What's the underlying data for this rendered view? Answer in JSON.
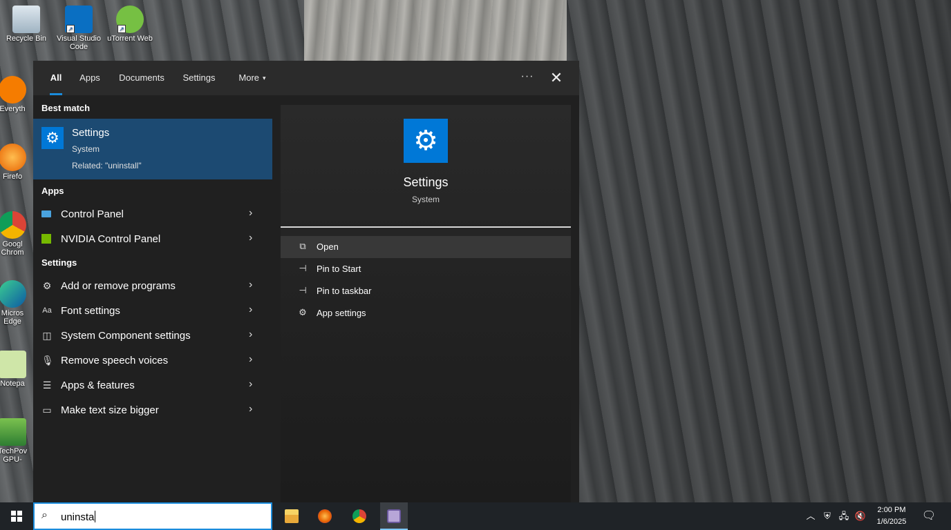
{
  "desktop": {
    "icons": [
      {
        "label": "Recycle Bin"
      },
      {
        "label": "Visual Studio Code"
      },
      {
        "label": "uTorrent Web"
      },
      {
        "label": "Everyth"
      },
      {
        "label": "Firefo"
      },
      {
        "label": "Googl Chrom"
      },
      {
        "label": "Micros Edge"
      },
      {
        "label": "Notepa"
      },
      {
        "label": "TechPov GPU-"
      }
    ]
  },
  "search_panel": {
    "tabs": [
      {
        "label": "All",
        "active": true
      },
      {
        "label": "Apps"
      },
      {
        "label": "Documents"
      },
      {
        "label": "Settings"
      },
      {
        "label": "More"
      }
    ],
    "more_caret": "▾",
    "ellipsis": "···",
    "close": "✕",
    "best_match": {
      "heading": "Best match",
      "title": "Settings",
      "subtitle": "System",
      "related": "Related: \"uninstall\"",
      "icon": "gear-icon"
    },
    "apps": {
      "heading": "Apps",
      "items": [
        {
          "label": "Control Panel",
          "icon": "control-panel-icon"
        },
        {
          "label": "NVIDIA Control Panel",
          "icon": "nvidia-icon"
        }
      ]
    },
    "settings": {
      "heading": "Settings",
      "items": [
        {
          "label": "Add or remove programs",
          "icon": "gear-icon"
        },
        {
          "label": "Font settings",
          "icon": "font-icon"
        },
        {
          "label": "System Component settings",
          "icon": "window-icon"
        },
        {
          "label": "Remove speech voices",
          "icon": "microphone-icon"
        },
        {
          "label": "Apps & features",
          "icon": "list-icon"
        },
        {
          "label": "Make text size bigger",
          "icon": "monitor-icon"
        }
      ]
    },
    "preview": {
      "title": "Settings",
      "subtitle": "System",
      "actions": [
        {
          "label": "Open",
          "icon": "open-icon",
          "highlighted": true
        },
        {
          "label": "Pin to Start",
          "icon": "pin-icon"
        },
        {
          "label": "Pin to taskbar",
          "icon": "pin-icon"
        },
        {
          "label": "App settings",
          "icon": "gear-icon"
        }
      ]
    }
  },
  "taskbar": {
    "search_value": "uninsta",
    "apps": [
      "file-explorer-icon",
      "firefox-icon",
      "chrome-icon",
      "app-icon"
    ],
    "clock": {
      "time": "2:00 PM",
      "date": "1/6/2025"
    }
  },
  "colors": {
    "accent": "#0078d7",
    "best_match_bg": "#1c4a72",
    "panel_bg": "#202020",
    "tab_underline": "#1a8cdc"
  }
}
